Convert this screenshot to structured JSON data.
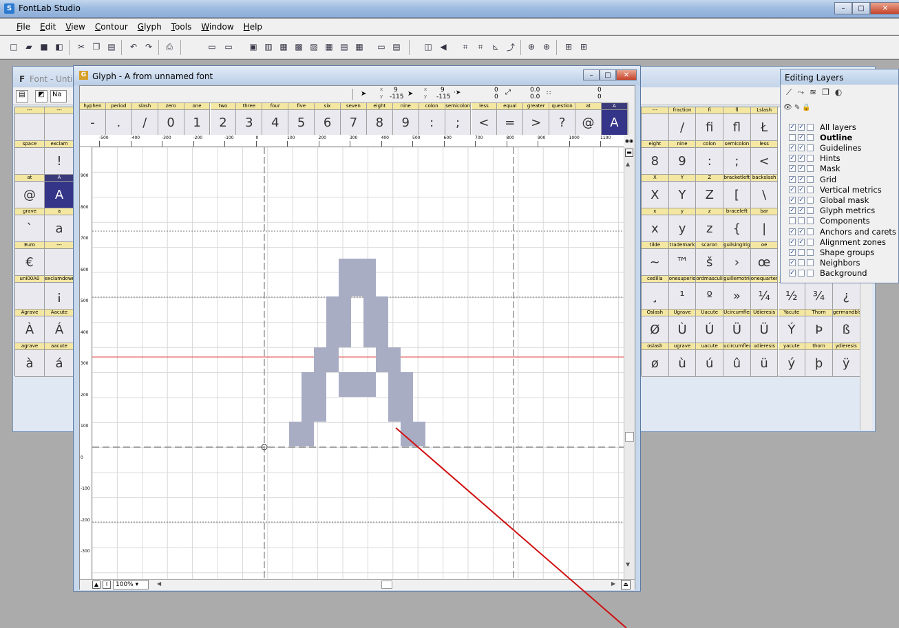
{
  "app": {
    "title": "FontLab Studio",
    "icon_letter": "S"
  },
  "window_buttons": {
    "minimize": "–",
    "maximize": "□",
    "close": "✕"
  },
  "menu": [
    "File",
    "Edit",
    "View",
    "Contour",
    "Glyph",
    "Tools",
    "Window",
    "Help"
  ],
  "font_window": {
    "title": "Font - Unti",
    "icon_letter": "F",
    "name_button": "Na"
  },
  "glyph_window": {
    "title": "Glyph - A from unnamed font",
    "icon_letter": "G",
    "coords": {
      "x1": "9",
      "y1": "-115",
      "x2": "9",
      "y2": "-115",
      "d1": "0",
      "d2": "0",
      "a1": "0.0",
      "a2": "0.0",
      "r": "0",
      "r2": "0"
    },
    "strip_names": [
      "hyphen",
      "period",
      "slash",
      "zero",
      "one",
      "two",
      "three",
      "four",
      "five",
      "six",
      "seven",
      "eight",
      "nine",
      "colon",
      "semicolon",
      "less",
      "equal",
      "greater",
      "question",
      "at",
      "A"
    ],
    "strip_glyphs": [
      "-",
      ".",
      "/",
      "0",
      "1",
      "2",
      "3",
      "4",
      "5",
      "6",
      "7",
      "8",
      "9",
      ":",
      ";",
      "<",
      "=",
      ">",
      "?",
      "@",
      "A"
    ],
    "ruler_top": [
      "-500",
      "-400",
      "-300",
      "-200",
      "-100",
      "0",
      "100",
      "200",
      "300",
      "400",
      "500",
      "600",
      "700",
      "800",
      "900",
      "1000",
      "1100"
    ],
    "ruler_left": [
      "900",
      "800",
      "700",
      "600",
      "500",
      "400",
      "300",
      "200",
      "100",
      "0",
      "-100",
      "-200",
      "-300",
      "-400"
    ],
    "zoom": "100%"
  },
  "font_grid_left": {
    "rows": [
      {
        "names": [
          "---",
          "---"
        ],
        "glyphs": [
          "",
          ""
        ]
      },
      {
        "names": [
          "space",
          "exclam"
        ],
        "glyphs": [
          "",
          "!"
        ]
      },
      {
        "names": [
          "at",
          "A"
        ],
        "glyphs": [
          "@",
          "A"
        ]
      },
      {
        "names": [
          "grave",
          "a"
        ],
        "glyphs": [
          "`",
          "a"
        ]
      },
      {
        "names": [
          "Euro",
          "---"
        ],
        "glyphs": [
          "€",
          ""
        ]
      },
      {
        "names": [
          "uni00A0",
          "exclamdown"
        ],
        "glyphs": [
          "",
          "¡"
        ]
      },
      {
        "names": [
          "Agrave",
          "Aacute"
        ],
        "glyphs": [
          "À",
          "Á"
        ]
      },
      {
        "names": [
          "agrave",
          "aacute"
        ],
        "glyphs": [
          "à",
          "á"
        ]
      }
    ]
  },
  "font_grid_right": {
    "rows": [
      {
        "names": [
          "---",
          "fraction",
          "fi",
          "fl",
          "Lslash"
        ],
        "glyphs": [
          "",
          "/",
          "ﬁ",
          "ﬂ",
          "Ł"
        ]
      },
      {
        "names": [
          "eight",
          "nine",
          "colon",
          "semicolon",
          "less"
        ],
        "glyphs": [
          "8",
          "9",
          ":",
          ";",
          "<"
        ]
      },
      {
        "names": [
          "X",
          "Y",
          "Z",
          "bracketleft",
          "backslash"
        ],
        "glyphs": [
          "X",
          "Y",
          "Z",
          "[",
          "\\"
        ]
      },
      {
        "names": [
          "x",
          "y",
          "z",
          "braceleft",
          "bar"
        ],
        "glyphs": [
          "x",
          "y",
          "z",
          "{",
          "|"
        ]
      },
      {
        "names": [
          "tilde",
          "trademark",
          "scaron",
          "guilsinglright",
          "oe"
        ],
        "glyphs": [
          "~",
          "™",
          "š",
          "›",
          "œ"
        ]
      },
      {
        "names": [
          "cedilla",
          "onesuperior",
          "ordmasculine",
          "guillemotright",
          "onequarter",
          "onehalf",
          "threequarters",
          "questiondown"
        ],
        "glyphs": [
          "¸",
          "¹",
          "º",
          "»",
          "¼",
          "½",
          "¾",
          "¿"
        ]
      },
      {
        "names": [
          "Oslash",
          "Ugrave",
          "Uacute",
          "Ucircumflex",
          "Udieresis",
          "Yacute",
          "Thorn",
          "germandbls"
        ],
        "glyphs": [
          "Ø",
          "Ù",
          "Ú",
          "Ü",
          "Ü",
          "Ý",
          "Þ",
          "ß"
        ]
      },
      {
        "names": [
          "oslash",
          "ugrave",
          "uacute",
          "ucircumflex",
          "udieresis",
          "yacute",
          "thorn",
          "ydieresis"
        ],
        "glyphs": [
          "ø",
          "ù",
          "ú",
          "û",
          "ü",
          "ý",
          "þ",
          "ÿ"
        ]
      }
    ]
  },
  "layers_panel": {
    "title": "Editing Layers",
    "layers": [
      {
        "name": "All layers",
        "checks": [
          true,
          true,
          false
        ],
        "bold": false
      },
      {
        "name": "Outline",
        "checks": [
          false,
          true,
          false
        ],
        "bold": true
      },
      {
        "name": "Guidelines",
        "checks": [
          true,
          true,
          false
        ],
        "bold": false
      },
      {
        "name": "Hints",
        "checks": [
          true,
          true,
          false
        ],
        "bold": false
      },
      {
        "name": "Mask",
        "checks": [
          true,
          true,
          false
        ],
        "bold": false
      },
      {
        "name": "Grid",
        "checks": [
          true,
          true,
          false
        ],
        "bold": false
      },
      {
        "name": "Vertical metrics",
        "checks": [
          true,
          true,
          false
        ],
        "bold": false
      },
      {
        "name": "Global mask",
        "checks": [
          true,
          true,
          false
        ],
        "bold": false
      },
      {
        "name": "Glyph metrics",
        "checks": [
          true,
          true,
          false
        ],
        "bold": false
      },
      {
        "name": "Components",
        "checks": [
          false,
          false,
          false
        ],
        "bold": false
      },
      {
        "name": "Anchors and carets",
        "checks": [
          true,
          true,
          false
        ],
        "bold": false
      },
      {
        "name": "Alignment zones",
        "checks": [
          true,
          true,
          false
        ],
        "bold": false
      },
      {
        "name": "Shape groups",
        "checks": [
          true,
          false,
          false
        ],
        "bold": false
      },
      {
        "name": "Neighbors",
        "checks": [
          true,
          false,
          false
        ],
        "bold": false
      },
      {
        "name": "Background",
        "checks": [
          true,
          false,
          false
        ],
        "bold": false
      }
    ]
  },
  "colors": {
    "accent": "#343488",
    "glyph_fill": "#a9adc4",
    "name_bg": "#f4e7a2",
    "annotation_arrow": "#d01010",
    "baseline_red": "#e04040"
  }
}
